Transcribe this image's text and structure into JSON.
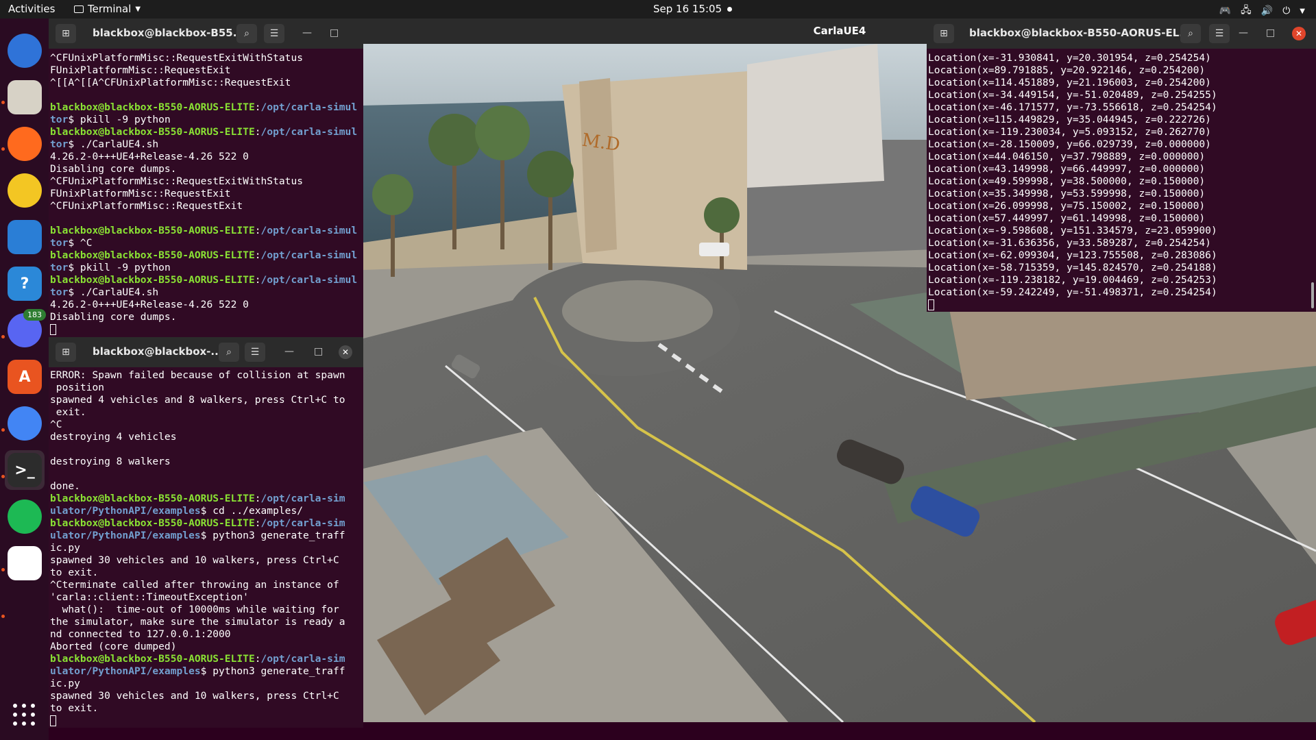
{
  "topbar": {
    "activities": "Activities",
    "app_name": "Terminal",
    "datetime": "Sep 16  15:05",
    "tray_icons": [
      "discord-tray-icon",
      "network-icon",
      "volume-icon",
      "power-icon"
    ]
  },
  "dock": {
    "items": [
      {
        "name": "thunderbird",
        "label": "",
        "color": "#2f73d8"
      },
      {
        "name": "files",
        "label": "",
        "color": "#d7d2c6"
      },
      {
        "name": "firefox",
        "label": "",
        "color": "#ff6a1e"
      },
      {
        "name": "rhythmbox",
        "label": "",
        "color": "#f3c623"
      },
      {
        "name": "libreoffice-writer",
        "label": "",
        "color": "#2a7ed6"
      },
      {
        "name": "help",
        "label": "?",
        "color": "#2b88d8"
      },
      {
        "name": "discord",
        "label": "",
        "color": "#5865f2",
        "badge": "183"
      },
      {
        "name": "ubuntu-software",
        "label": "A",
        "color": "#e95420"
      },
      {
        "name": "chrome",
        "label": "",
        "color": "#4285f4"
      },
      {
        "name": "terminal",
        "label": ">_",
        "color": "#2c2c2c"
      },
      {
        "name": "spotify",
        "label": "",
        "color": "#1db954"
      },
      {
        "name": "text-editor",
        "label": "",
        "color": "#ffffff"
      }
    ],
    "apps_grid": "show-applications"
  },
  "term_top_left": {
    "title": "blackbox@blackbox-B55...",
    "lines": [
      [
        {
          "t": "^CFUnixPlatformMisc::RequestExitWithStatus"
        }
      ],
      [
        {
          "t": "FUnixPlatformMisc::RequestExit"
        }
      ],
      [
        {
          "t": "^[[A^[[A^CFUnixPlatformMisc::RequestExit"
        }
      ],
      [
        {
          "t": ""
        }
      ],
      [
        {
          "t": "blackbox@blackbox-B550-AORUS-ELITE",
          "c": "g"
        },
        {
          "t": ":"
        },
        {
          "t": "/opt/carla-simul",
          "c": "b"
        }
      ],
      [
        {
          "t": "tor",
          "c": "b"
        },
        {
          "t": "$ pkill -9 python"
        }
      ],
      [
        {
          "t": "blackbox@blackbox-B550-AORUS-ELITE",
          "c": "g"
        },
        {
          "t": ":"
        },
        {
          "t": "/opt/carla-simul",
          "c": "b"
        }
      ],
      [
        {
          "t": "tor",
          "c": "b"
        },
        {
          "t": "$ ./CarlaUE4.sh"
        }
      ],
      [
        {
          "t": "4.26.2-0+++UE4+Release-4.26 522 0"
        }
      ],
      [
        {
          "t": "Disabling core dumps."
        }
      ],
      [
        {
          "t": "^CFUnixPlatformMisc::RequestExitWithStatus"
        }
      ],
      [
        {
          "t": "FUnixPlatformMisc::RequestExit"
        }
      ],
      [
        {
          "t": "^CFUnixPlatformMisc::RequestExit"
        }
      ],
      [
        {
          "t": ""
        }
      ],
      [
        {
          "t": "blackbox@blackbox-B550-AORUS-ELITE",
          "c": "g"
        },
        {
          "t": ":"
        },
        {
          "t": "/opt/carla-simul",
          "c": "b"
        }
      ],
      [
        {
          "t": "tor",
          "c": "b"
        },
        {
          "t": "$ ^C"
        }
      ],
      [
        {
          "t": "blackbox@blackbox-B550-AORUS-ELITE",
          "c": "g"
        },
        {
          "t": ":"
        },
        {
          "t": "/opt/carla-simul",
          "c": "b"
        }
      ],
      [
        {
          "t": "tor",
          "c": "b"
        },
        {
          "t": "$ pkill -9 python"
        }
      ],
      [
        {
          "t": "blackbox@blackbox-B550-AORUS-ELITE",
          "c": "g"
        },
        {
          "t": ":"
        },
        {
          "t": "/opt/carla-simul",
          "c": "b"
        }
      ],
      [
        {
          "t": "tor",
          "c": "b"
        },
        {
          "t": "$ ./CarlaUE4.sh"
        }
      ],
      [
        {
          "t": "4.26.2-0+++UE4+Release-4.26 522 0"
        }
      ],
      [
        {
          "t": "Disabling core dumps."
        }
      ],
      [
        {
          "t": "",
          "cursor": true
        }
      ]
    ]
  },
  "term_bottom_left": {
    "title": "blackbox@blackbox-...",
    "lines": [
      [
        {
          "t": "ERROR: Spawn failed because of collision at spawn"
        }
      ],
      [
        {
          "t": " position"
        }
      ],
      [
        {
          "t": "spawned 4 vehicles and 8 walkers, press Ctrl+C to"
        }
      ],
      [
        {
          "t": " exit."
        }
      ],
      [
        {
          "t": "^C"
        }
      ],
      [
        {
          "t": "destroying 4 vehicles"
        }
      ],
      [
        {
          "t": ""
        }
      ],
      [
        {
          "t": "destroying 8 walkers"
        }
      ],
      [
        {
          "t": ""
        }
      ],
      [
        {
          "t": "done."
        }
      ],
      [
        {
          "t": "blackbox@blackbox-B550-AORUS-ELITE",
          "c": "g"
        },
        {
          "t": ":"
        },
        {
          "t": "/opt/carla-sim",
          "c": "b"
        }
      ],
      [
        {
          "t": "ulator/PythonAPI/examples",
          "c": "b"
        },
        {
          "t": "$ cd ../examples/"
        }
      ],
      [
        {
          "t": "blackbox@blackbox-B550-AORUS-ELITE",
          "c": "g"
        },
        {
          "t": ":"
        },
        {
          "t": "/opt/carla-sim",
          "c": "b"
        }
      ],
      [
        {
          "t": "ulator/PythonAPI/examples",
          "c": "b"
        },
        {
          "t": "$ python3 generate_traff"
        }
      ],
      [
        {
          "t": "ic.py"
        }
      ],
      [
        {
          "t": "spawned 30 vehicles and 10 walkers, press Ctrl+C"
        }
      ],
      [
        {
          "t": "to exit."
        }
      ],
      [
        {
          "t": "^Cterminate called after throwing an instance of"
        }
      ],
      [
        {
          "t": "'carla::client::TimeoutException'"
        }
      ],
      [
        {
          "t": "  what():  time-out of 10000ms while waiting for"
        }
      ],
      [
        {
          "t": "the simulator, make sure the simulator is ready a"
        }
      ],
      [
        {
          "t": "nd connected to 127.0.0.1:2000"
        }
      ],
      [
        {
          "t": "Aborted (core dumped)"
        }
      ],
      [
        {
          "t": "blackbox@blackbox-B550-AORUS-ELITE",
          "c": "g"
        },
        {
          "t": ":"
        },
        {
          "t": "/opt/carla-sim",
          "c": "b"
        }
      ],
      [
        {
          "t": "ulator/PythonAPI/examples",
          "c": "b"
        },
        {
          "t": "$ python3 generate_traff"
        }
      ],
      [
        {
          "t": "ic.py"
        }
      ],
      [
        {
          "t": "spawned 30 vehicles and 10 walkers, press Ctrl+C"
        }
      ],
      [
        {
          "t": "to exit."
        }
      ],
      [
        {
          "t": "",
          "cursor": true
        }
      ]
    ]
  },
  "term_right": {
    "title": "blackbox@blackbox-B550-AORUS-EL...",
    "lines": [
      [
        {
          "t": "Location(x=-31.930841, y=20.301954, z=0.254254)"
        }
      ],
      [
        {
          "t": "Location(x=89.791885, y=20.922146, z=0.254200)"
        }
      ],
      [
        {
          "t": "Location(x=114.451889, y=21.196003, z=0.254200)"
        }
      ],
      [
        {
          "t": "Location(x=-34.449154, y=-51.020489, z=0.254255)"
        }
      ],
      [
        {
          "t": "Location(x=-46.171577, y=-73.556618, z=0.254254)"
        }
      ],
      [
        {
          "t": "Location(x=115.449829, y=35.044945, z=0.222726)"
        }
      ],
      [
        {
          "t": "Location(x=-119.230034, y=5.093152, z=0.262770)"
        }
      ],
      [
        {
          "t": "Location(x=-28.150009, y=66.029739, z=0.000000)"
        }
      ],
      [
        {
          "t": "Location(x=44.046150, y=37.798889, z=0.000000)"
        }
      ],
      [
        {
          "t": "Location(x=43.149998, y=66.449997, z=0.000000)"
        }
      ],
      [
        {
          "t": "Location(x=49.599998, y=38.500000, z=0.150000)"
        }
      ],
      [
        {
          "t": "Location(x=35.349998, y=53.599998, z=0.150000)"
        }
      ],
      [
        {
          "t": "Location(x=26.099998, y=75.150002, z=0.150000)"
        }
      ],
      [
        {
          "t": "Location(x=57.449997, y=61.149998, z=0.150000)"
        }
      ],
      [
        {
          "t": "Location(x=-9.598608, y=151.334579, z=23.059900)"
        }
      ],
      [
        {
          "t": "Location(x=-31.636356, y=33.589287, z=0.254254)"
        }
      ],
      [
        {
          "t": "Location(x=-62.099304, y=123.755508, z=0.283086)"
        }
      ],
      [
        {
          "t": "Location(x=-58.715359, y=145.824570, z=0.254188)"
        }
      ],
      [
        {
          "t": "Location(x=-119.238182, y=19.004469, z=0.254253)"
        }
      ],
      [
        {
          "t": "Location(x=-59.242249, y=-51.498371, z=0.254254)"
        }
      ],
      [
        {
          "t": "",
          "cursor": true
        }
      ]
    ]
  },
  "carla": {
    "title": "CarlaUE4",
    "hotel_sign": "M.D"
  },
  "colors": {
    "terminal_bg": "#300a24",
    "prompt_user": "#8ae234",
    "prompt_path": "#729fcf",
    "close_button": "#e0452b",
    "ubuntu_orange": "#e95420"
  }
}
